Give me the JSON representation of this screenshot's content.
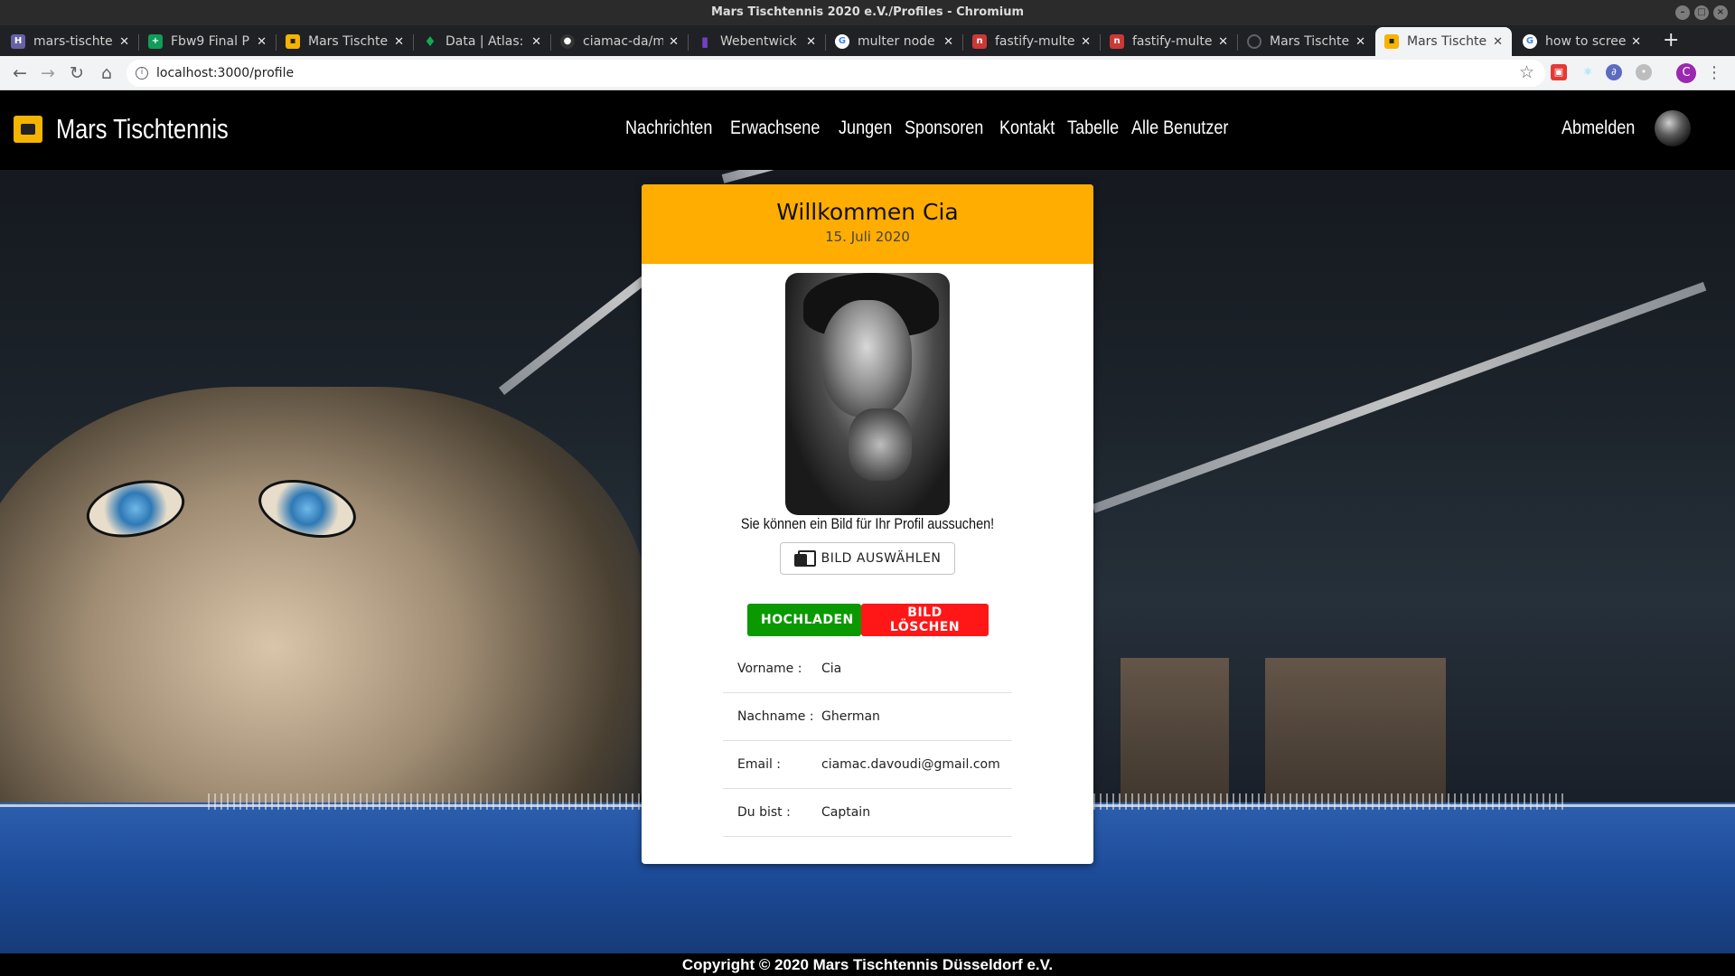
{
  "window": {
    "title": "Mars Tischtennis 2020 e.V./Profiles - Chromium"
  },
  "tabs": [
    {
      "label": "mars-tischte",
      "icon": "heroku-icon",
      "color": "#6762a6"
    },
    {
      "label": "Fbw9 Final P",
      "icon": "sheets-icon",
      "color": "#0f9d58"
    },
    {
      "label": "Mars Tischte",
      "icon": "site-logo-icon",
      "color": "#f5b400"
    },
    {
      "label": "Data | Atlas:",
      "icon": "mongodb-leaf-icon",
      "color": "#13aa52"
    },
    {
      "label": "ciamac-da/m",
      "icon": "github-icon",
      "color": "#333333"
    },
    {
      "label": "Webentwick",
      "icon": "bookmark-icon",
      "color": "#6f42c1"
    },
    {
      "label": "multer node",
      "icon": "google-icon",
      "color": "#ffffff"
    },
    {
      "label": "fastify-multe",
      "icon": "npm-icon",
      "color": "#cb3837"
    },
    {
      "label": "fastify-multe",
      "icon": "npm-icon",
      "color": "#cb3837"
    },
    {
      "label": "Mars Tischte",
      "icon": "loading-icon",
      "color": "#5f6368"
    },
    {
      "label": "Mars Tischte",
      "icon": "site-logo-icon",
      "color": "#f5b400"
    },
    {
      "label": "how to scree",
      "icon": "google-icon",
      "color": "#ffffff"
    }
  ],
  "address": {
    "url": "localhost:3000/profile"
  },
  "header": {
    "brand": "Mars Tischtennis",
    "nav": [
      "Nachrichten",
      "Erwachsene",
      "Jungen",
      "Sponsoren",
      "Kontakt",
      "Tabelle",
      "Alle Benutzer"
    ],
    "logout": "Abmelden"
  },
  "card": {
    "title": "Willkommen Cia",
    "date": "15. Juli 2020",
    "photo_hint": "Sie können ein Bild für Ihr Profil aussuchen!",
    "choose_label": "BILD AUSWÄHLEN",
    "upload_label": "HOCHLADEN",
    "delete_label": "BILD LÖSCHEN",
    "fields": [
      {
        "key": "Vorname :",
        "value": "Cia"
      },
      {
        "key": "Nachname :",
        "value": "Gherman"
      },
      {
        "key": "Email :",
        "value": "ciamac.davoudi@gmail.com"
      },
      {
        "key": "Du bist :",
        "value": "Captain"
      }
    ]
  },
  "footer": {
    "text": "Copyright © 2020  Mars Tischtennis Düsseldorf e.V."
  },
  "colors": {
    "card_header": "#ffad00",
    "upload_button": "#0a9a00",
    "delete_button": "#ff1717",
    "profile_avatar": "#9c27b0"
  }
}
